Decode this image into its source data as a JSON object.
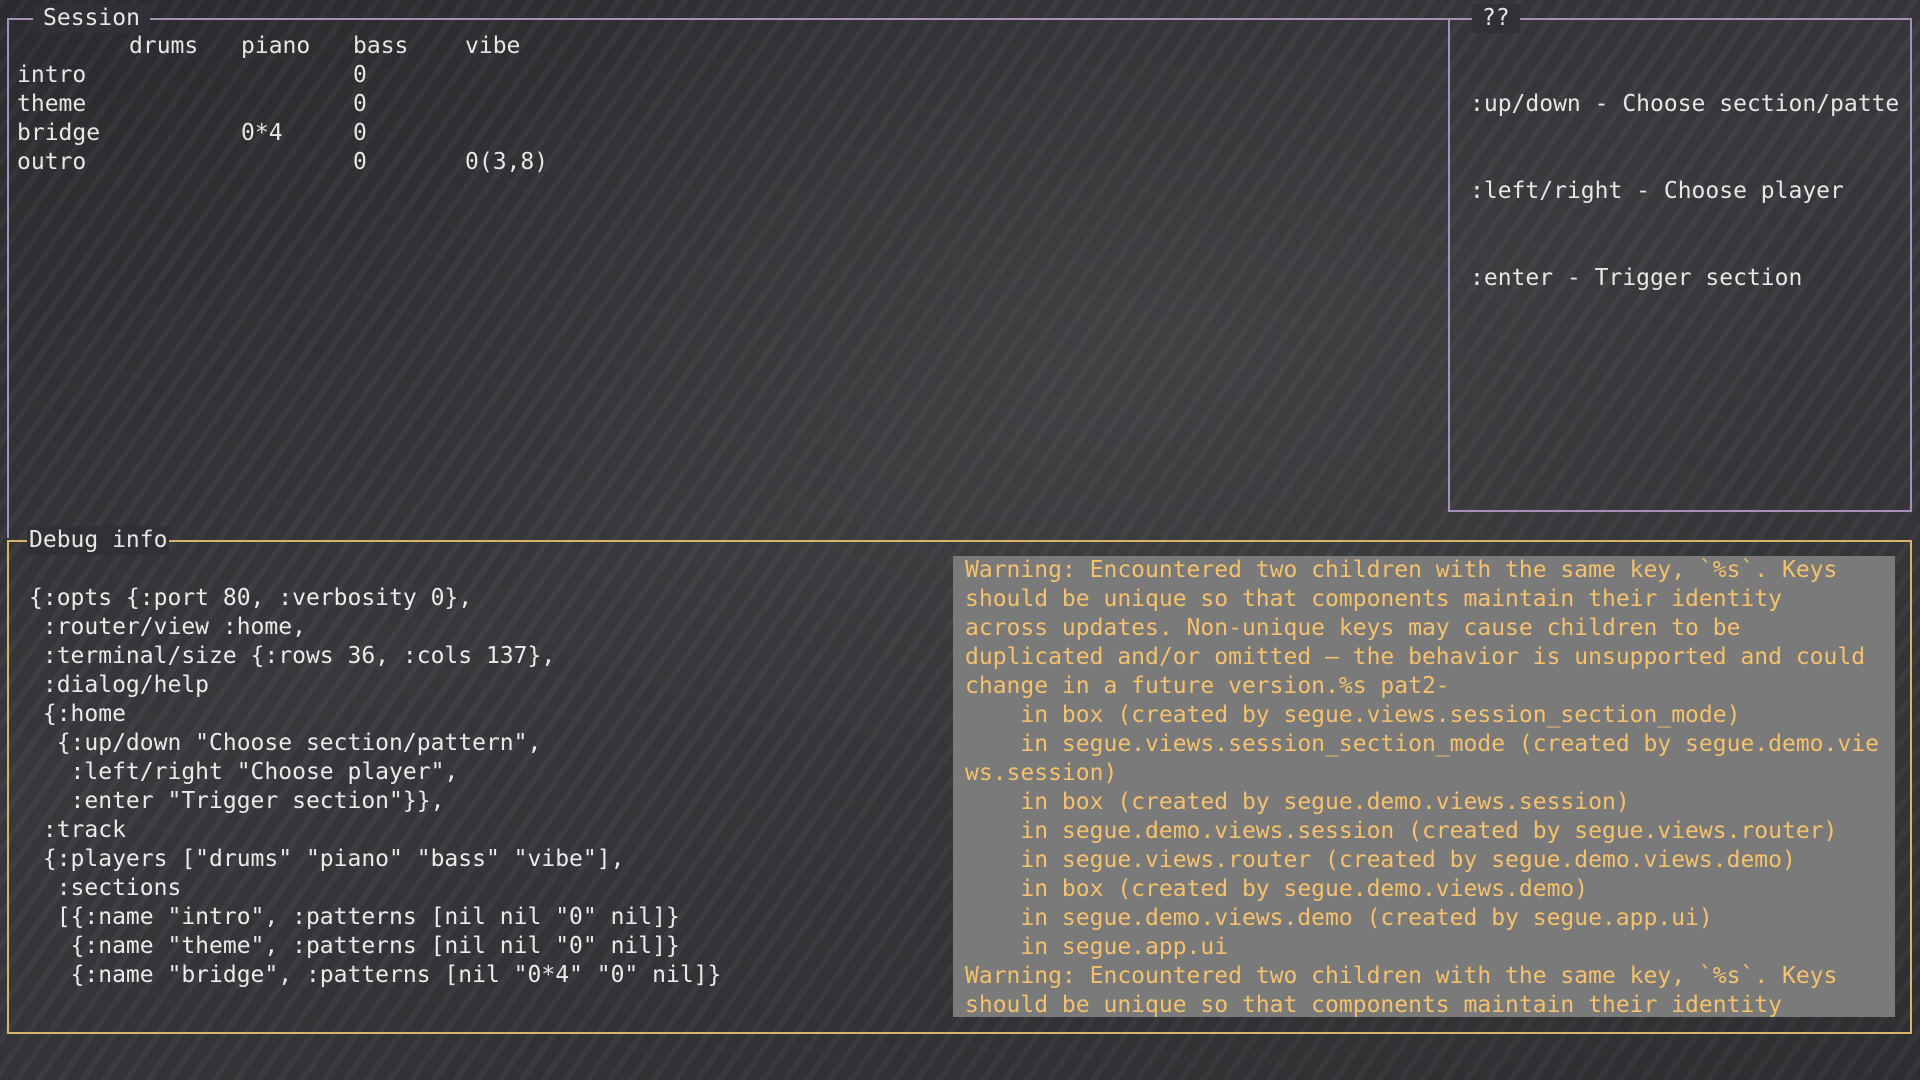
{
  "session": {
    "title": "Session",
    "columns": [
      "",
      "drums",
      "piano",
      "bass",
      "vibe"
    ],
    "rows": [
      {
        "name": "intro",
        "cells": [
          "",
          "",
          "0",
          ""
        ]
      },
      {
        "name": "theme",
        "cells": [
          "",
          "",
          "0",
          ""
        ]
      },
      {
        "name": "bridge",
        "cells": [
          "",
          "0*4",
          "0",
          ""
        ]
      },
      {
        "name": "outro",
        "cells": [
          "",
          "",
          "0",
          "0(3,8)"
        ]
      }
    ]
  },
  "help": {
    "title": "??",
    "lines": [
      ":up/down - Choose section/patte",
      ":left/right - Choose player",
      ":enter - Trigger section"
    ]
  },
  "debug": {
    "title": "Debug info",
    "state_lines": [
      "{:opts {:port 80, :verbosity 0},",
      " :router/view :home,",
      " :terminal/size {:rows 36, :cols 137},",
      " :dialog/help",
      " {:home",
      "  {:up/down \"Choose section/pattern\",",
      "   :left/right \"Choose player\",",
      "   :enter \"Trigger section\"}},",
      " :track",
      " {:players [\"drums\" \"piano\" \"bass\" \"vibe\"],",
      "  :sections",
      "  [{:name \"intro\", :patterns [nil nil \"0\" nil]}",
      "   {:name \"theme\", :patterns [nil nil \"0\" nil]}",
      "   {:name \"bridge\", :patterns [nil \"0*4\" \"0\" nil]}"
    ],
    "warning_lines": [
      "Warning: Encountered two children with the same key, `%s`. Keys",
      "should be unique so that components maintain their identity",
      "across updates. Non-unique keys may cause children to be",
      "duplicated and/or omitted — the behavior is unsupported and could",
      "change in a future version.%s pat2-",
      "    in box (created by segue.views.session_section_mode)",
      "    in segue.views.session_section_mode (created by segue.demo.vie",
      "ws.session)",
      "    in box (created by segue.demo.views.session)",
      "    in segue.demo.views.session (created by segue.views.router)",
      "    in segue.views.router (created by segue.demo.views.demo)",
      "    in box (created by segue.demo.views.demo)",
      "    in segue.demo.views.demo (created by segue.app.ui)",
      "    in segue.app.ui",
      "Warning: Encountered two children with the same key, `%s`. Keys",
      "should be unique so that components maintain their identity"
    ]
  },
  "colors": {
    "session_border": "#a98fb5",
    "debug_border": "#d9b36a",
    "warning_text": "#f5c26b",
    "warning_bg": "#7a7a7a"
  }
}
